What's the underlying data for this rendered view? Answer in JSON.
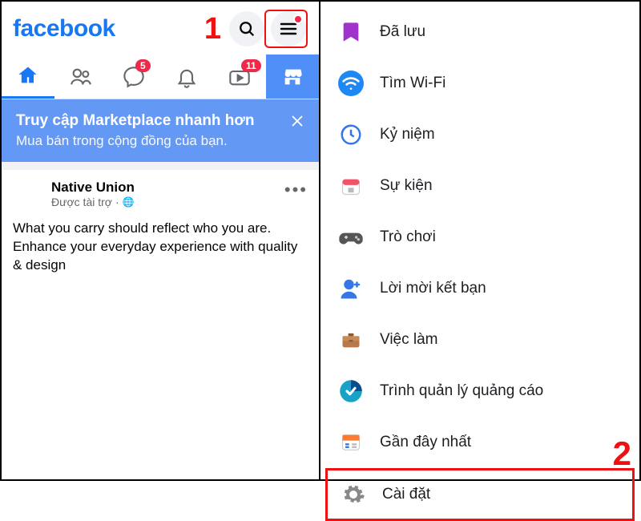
{
  "header": {
    "logo_text": "facebook",
    "step1_label": "1"
  },
  "tabs": {
    "friends_badge": "5",
    "watch_badge": "11"
  },
  "marketplace_banner": {
    "title": "Truy cập Marketplace nhanh hơn",
    "subtitle": "Mua bán trong cộng đồng của bạn."
  },
  "post": {
    "author": "Native Union",
    "meta": "Được tài trợ",
    "body": "What you carry should reflect who you are. Enhance your everyday experience with quality & design"
  },
  "menu": {
    "saved": "Đã lưu",
    "wifi": "Tìm Wi-Fi",
    "memories": "Kỷ niệm",
    "events": "Sự kiện",
    "games": "Trò chơi",
    "friend_requests": "Lời mời kết bạn",
    "jobs": "Việc làm",
    "ads_manager": "Trình quản lý quảng cáo",
    "recent": "Gần đây nhất",
    "settings": "Cài đặt"
  },
  "step2_label": "2"
}
